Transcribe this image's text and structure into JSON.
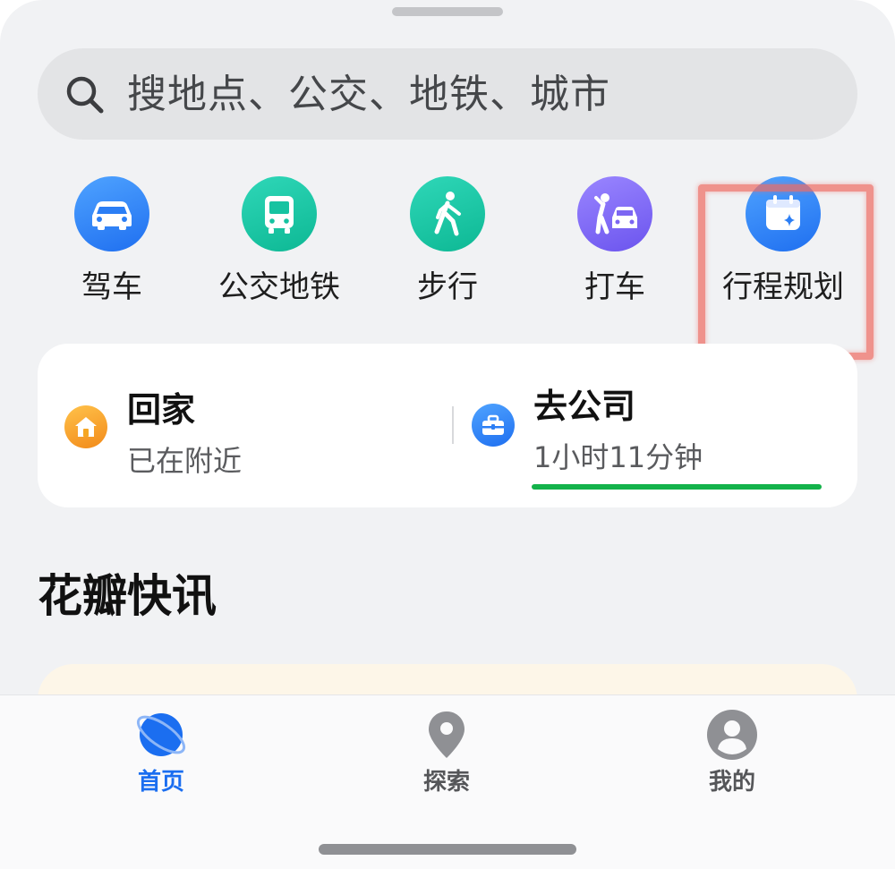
{
  "search": {
    "placeholder": "搜地点、公交、地铁、城市",
    "icon": "search-icon"
  },
  "quick_actions": [
    {
      "label": "驾车",
      "icon": "car-icon",
      "color": "#2b7ef5"
    },
    {
      "label": "公交地铁",
      "icon": "bus-icon",
      "color": "#16c3a1"
    },
    {
      "label": "步行",
      "icon": "walk-icon",
      "color": "#16c3a1"
    },
    {
      "label": "打车",
      "icon": "taxi-icon",
      "color": "#7c66f2"
    },
    {
      "label": "行程规划",
      "icon": "calendar-sparkle-icon",
      "color": "#2b7ef5"
    }
  ],
  "shortcuts": {
    "home": {
      "title": "回家",
      "subtitle": "已在附近",
      "icon": "home-icon",
      "color": "#f5a623"
    },
    "work": {
      "title": "去公司",
      "subtitle": "1小时11分钟",
      "icon": "briefcase-icon",
      "color": "#2b7ef5"
    }
  },
  "route_status_color": "#13b24a",
  "highlight_color": "#ee6c64",
  "section": {
    "title": "花瓣快讯"
  },
  "tabs": [
    {
      "label": "首页",
      "icon": "globe-icon",
      "active": true,
      "color": "#1b6ef0"
    },
    {
      "label": "探索",
      "icon": "location-pin-icon",
      "active": false,
      "color": "#555659"
    },
    {
      "label": "我的",
      "icon": "person-icon",
      "active": false,
      "color": "#555659"
    }
  ]
}
